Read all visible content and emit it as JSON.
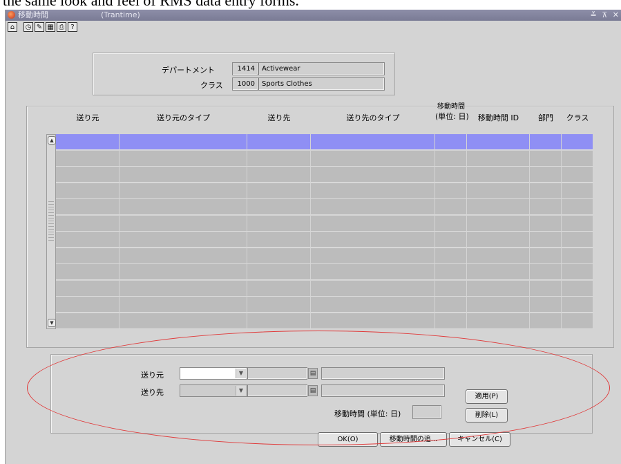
{
  "doc": {
    "caption_fragment": "the same look and feel of RMS data entry forms."
  },
  "window": {
    "title": "移動時間",
    "subtitle": "(Trantime)",
    "controls": "≚ ⊼ ✕"
  },
  "toolbar": {
    "items": [
      {
        "name": "home-icon",
        "glyph": "⌂"
      },
      {
        "name": "clock-icon",
        "glyph": "◷"
      },
      {
        "name": "spell-check-icon",
        "glyph": "✎"
      },
      {
        "name": "calendar-icon",
        "glyph": "▦"
      },
      {
        "name": "print-icon",
        "glyph": "⎙"
      },
      {
        "name": "help-icon",
        "glyph": "?"
      }
    ]
  },
  "header": {
    "department_label": "デパートメント",
    "department_code": "1414",
    "department_name": "Activewear",
    "class_label": "クラス",
    "class_code": "1000",
    "class_name": "Sports Clothes"
  },
  "table": {
    "columns": [
      {
        "label": "送り元",
        "label2": ""
      },
      {
        "label": "送り元のタイプ",
        "label2": ""
      },
      {
        "label": "送り先",
        "label2": ""
      },
      {
        "label": "送り先のタイプ",
        "label2": ""
      },
      {
        "label": "移動時間",
        "label2": "(単位: 日)"
      },
      {
        "label": "移動時間 ID",
        "label2": ""
      },
      {
        "label": "部門",
        "label2": ""
      },
      {
        "label": "クラス",
        "label2": ""
      }
    ],
    "row_count": 12,
    "selected_row": 0
  },
  "form": {
    "from_label": "送り元",
    "to_label": "送り先",
    "transit_time_label": "移動時間 (単位: 日)",
    "apply_button": "適用(P)",
    "delete_button": "削除(L)"
  },
  "buttons": {
    "ok": "OK(O)",
    "add_transit": "移動時間の追...",
    "cancel": "キャンセル(C)"
  },
  "colors": {
    "selection": "#8f8ff4",
    "annotation": "#e03a3a"
  }
}
